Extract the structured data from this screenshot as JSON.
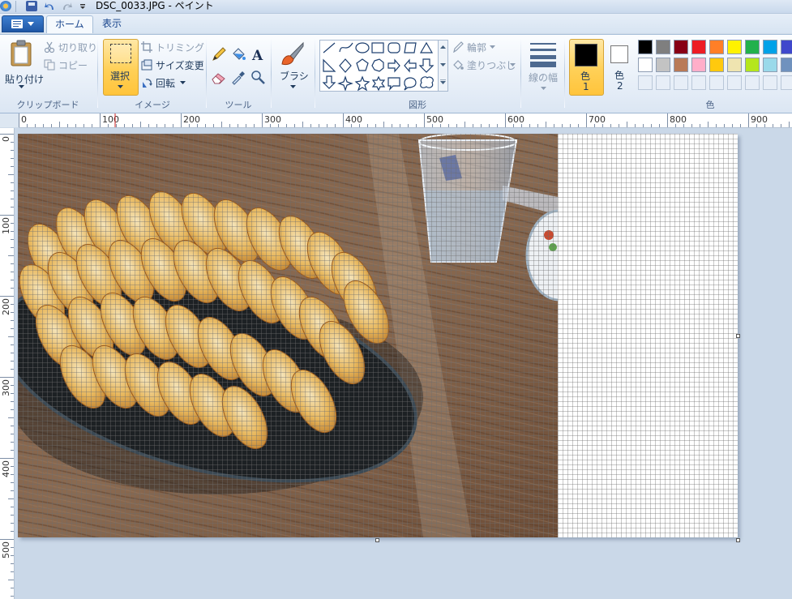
{
  "window": {
    "title": "DSC_0033.JPG - ペイント"
  },
  "tabs": [
    {
      "label": "ホーム",
      "active": true
    },
    {
      "label": "表示",
      "active": false
    }
  ],
  "groups": {
    "clipboard": {
      "label": "クリップボード",
      "paste": "貼り付け",
      "cut": "切り取り",
      "copy": "コピー"
    },
    "image": {
      "label": "イメージ",
      "select": "選択",
      "crop": "トリミング",
      "resize": "サイズ変更",
      "rotate": "回転"
    },
    "tools": {
      "label": "ツール"
    },
    "brushes": {
      "label": "ブラシ"
    },
    "shapes": {
      "label": "図形",
      "outline": "輪郭",
      "fill": "塗りつぶし"
    },
    "size": {
      "label": "線の幅"
    },
    "colors": {
      "label": "色",
      "color1": "色",
      "color1_num": "1",
      "color2": "色",
      "color2_num": "2",
      "color1_value": "#000000",
      "color2_value": "#ffffff",
      "palette_row1": [
        "#000000",
        "#7f7f7f",
        "#880015",
        "#ed1c24",
        "#ff7f27",
        "#fff200",
        "#22b14c",
        "#00a2e8",
        "#3f48cc"
      ],
      "palette_row2": [
        "#ffffff",
        "#c3c3c3",
        "#b97a57",
        "#ffaec9",
        "#ffc90e",
        "#efe4b0",
        "#b5e61d",
        "#99d9ea",
        "#7092be"
      ]
    }
  },
  "ruler": {
    "horizontal": [
      "0",
      "100",
      "200",
      "300",
      "400",
      "500",
      "600",
      "700",
      "800",
      "900"
    ],
    "vertical": [
      "0",
      "100",
      "200",
      "300",
      "400",
      "500"
    ]
  }
}
